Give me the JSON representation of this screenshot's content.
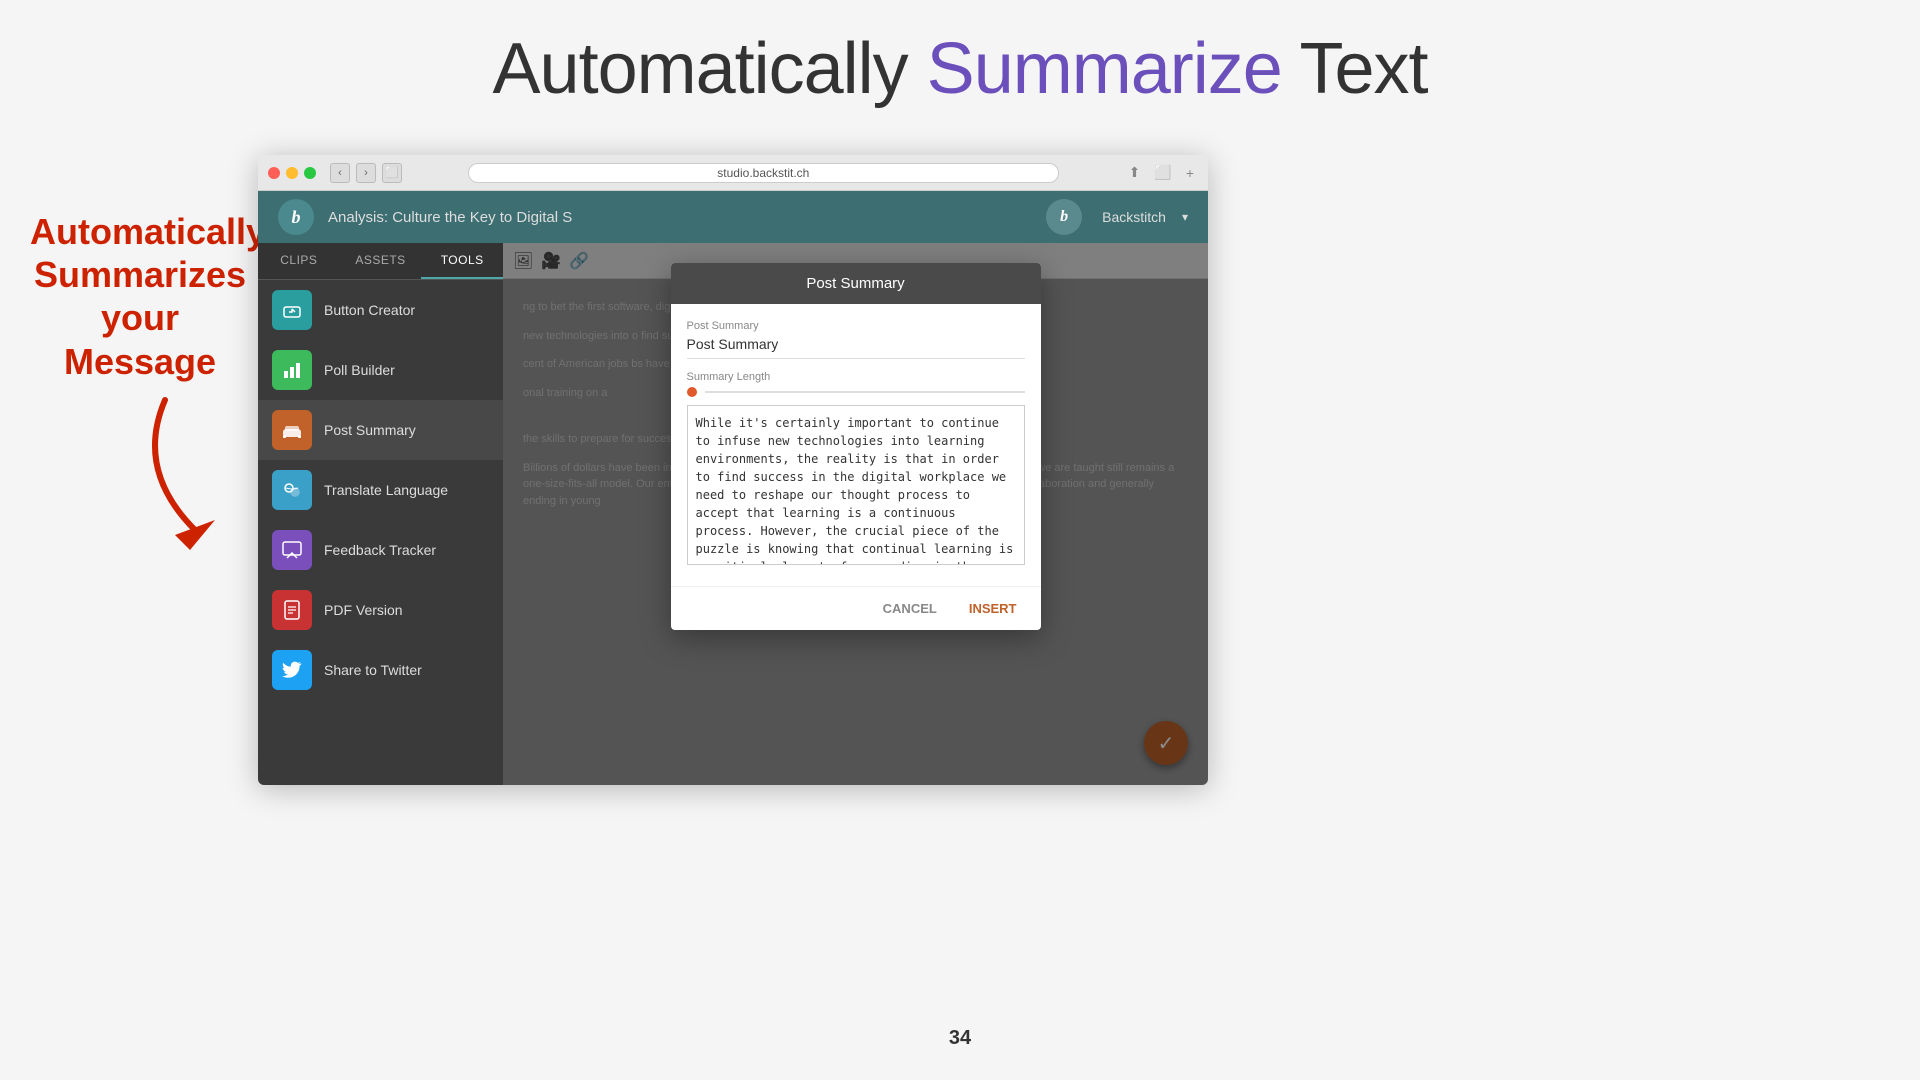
{
  "slide": {
    "title_part1": "Automatically ",
    "title_part2": "Summarize",
    "title_part3": " Text",
    "page_number": "34"
  },
  "annotation": {
    "line1": "Automatically",
    "line2": "Summarizes",
    "line3": "your Message"
  },
  "browser": {
    "url": "studio.backstit.ch"
  },
  "app": {
    "title": "Analysis: Culture the Key to Digital S",
    "user": "Backstitch",
    "logo_letter": "b"
  },
  "sidebar": {
    "tabs": [
      {
        "label": "CLIPS",
        "active": false
      },
      {
        "label": "ASSETS",
        "active": false
      },
      {
        "label": "TOOLS",
        "active": true
      }
    ],
    "items": [
      {
        "label": "Button Creator",
        "icon": "🖱️",
        "iconClass": "icon-teal"
      },
      {
        "label": "Poll Builder",
        "icon": "📊",
        "iconClass": "icon-green"
      },
      {
        "label": "Post Summary",
        "icon": "🛋️",
        "iconClass": "icon-sofa",
        "active": true
      },
      {
        "label": "Translate Language",
        "icon": "👥",
        "iconClass": "icon-translate"
      },
      {
        "label": "Feedback Tracker",
        "icon": "💬",
        "iconClass": "icon-purple"
      },
      {
        "label": "PDF Version",
        "icon": "📄",
        "iconClass": "icon-red"
      },
      {
        "label": "Share to Twitter",
        "icon": "🐦",
        "iconClass": "icon-twitter"
      }
    ]
  },
  "modal": {
    "title": "Post Summary",
    "field_label": "Post Summary",
    "field_value": "Post Summary",
    "summary_length_label": "Summary Length",
    "textarea_content": "While it's certainly important to continue to infuse new technologies into learning environments, the reality is that in order to find success in the digital workplace we need to reshape our thought process to accept that learning is a continuous process. However, the crucial piece of the puzzle is knowing that continual learning is a critical element of succeeding in the future digital workplace. While primary education enables students to gain the skills to prepare for success in the traditional workplace, what about the digital workplace?",
    "cancel_btn": "CANCEL",
    "insert_btn": "INSERT"
  },
  "article": {
    "paragraphs": [
      "ng to bet the first software, digital e list goes on. Yet, ng directly correlates",
      "new technologies into o find success in the process to accept that",
      "cent of American jobs bs have the potential be created and less",
      "onal training on a",
      "the skills to prepare for success in the traditional workplace, what about the digital workplace?",
      "Billions of dollars have been invested in technologies that make learning easier and more fun but the way we are taught still remains a one-size-fits-all model. Our entire standard approach to education — top-down, heavily biased against collaboration and generally ending in young"
    ]
  },
  "icons": {
    "back": "‹",
    "forward": "›",
    "tab": "⬜",
    "share": "⬆",
    "new_tab": "+",
    "refresh": "↻",
    "image": "🖼",
    "video": "🎥",
    "link": "🔗",
    "check": "✓"
  }
}
